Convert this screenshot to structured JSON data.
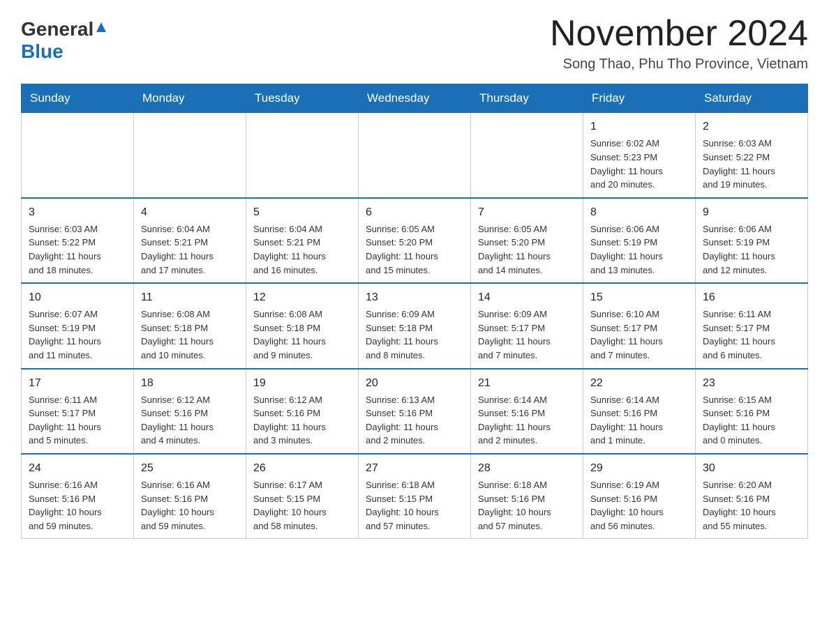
{
  "header": {
    "logo_general": "General",
    "logo_blue": "Blue",
    "month_title": "November 2024",
    "subtitle": "Song Thao, Phu Tho Province, Vietnam"
  },
  "calendar": {
    "days_of_week": [
      "Sunday",
      "Monday",
      "Tuesday",
      "Wednesday",
      "Thursday",
      "Friday",
      "Saturday"
    ],
    "weeks": [
      [
        {
          "day": "",
          "info": ""
        },
        {
          "day": "",
          "info": ""
        },
        {
          "day": "",
          "info": ""
        },
        {
          "day": "",
          "info": ""
        },
        {
          "day": "",
          "info": ""
        },
        {
          "day": "1",
          "info": "Sunrise: 6:02 AM\nSunset: 5:23 PM\nDaylight: 11 hours\nand 20 minutes."
        },
        {
          "day": "2",
          "info": "Sunrise: 6:03 AM\nSunset: 5:22 PM\nDaylight: 11 hours\nand 19 minutes."
        }
      ],
      [
        {
          "day": "3",
          "info": "Sunrise: 6:03 AM\nSunset: 5:22 PM\nDaylight: 11 hours\nand 18 minutes."
        },
        {
          "day": "4",
          "info": "Sunrise: 6:04 AM\nSunset: 5:21 PM\nDaylight: 11 hours\nand 17 minutes."
        },
        {
          "day": "5",
          "info": "Sunrise: 6:04 AM\nSunset: 5:21 PM\nDaylight: 11 hours\nand 16 minutes."
        },
        {
          "day": "6",
          "info": "Sunrise: 6:05 AM\nSunset: 5:20 PM\nDaylight: 11 hours\nand 15 minutes."
        },
        {
          "day": "7",
          "info": "Sunrise: 6:05 AM\nSunset: 5:20 PM\nDaylight: 11 hours\nand 14 minutes."
        },
        {
          "day": "8",
          "info": "Sunrise: 6:06 AM\nSunset: 5:19 PM\nDaylight: 11 hours\nand 13 minutes."
        },
        {
          "day": "9",
          "info": "Sunrise: 6:06 AM\nSunset: 5:19 PM\nDaylight: 11 hours\nand 12 minutes."
        }
      ],
      [
        {
          "day": "10",
          "info": "Sunrise: 6:07 AM\nSunset: 5:19 PM\nDaylight: 11 hours\nand 11 minutes."
        },
        {
          "day": "11",
          "info": "Sunrise: 6:08 AM\nSunset: 5:18 PM\nDaylight: 11 hours\nand 10 minutes."
        },
        {
          "day": "12",
          "info": "Sunrise: 6:08 AM\nSunset: 5:18 PM\nDaylight: 11 hours\nand 9 minutes."
        },
        {
          "day": "13",
          "info": "Sunrise: 6:09 AM\nSunset: 5:18 PM\nDaylight: 11 hours\nand 8 minutes."
        },
        {
          "day": "14",
          "info": "Sunrise: 6:09 AM\nSunset: 5:17 PM\nDaylight: 11 hours\nand 7 minutes."
        },
        {
          "day": "15",
          "info": "Sunrise: 6:10 AM\nSunset: 5:17 PM\nDaylight: 11 hours\nand 7 minutes."
        },
        {
          "day": "16",
          "info": "Sunrise: 6:11 AM\nSunset: 5:17 PM\nDaylight: 11 hours\nand 6 minutes."
        }
      ],
      [
        {
          "day": "17",
          "info": "Sunrise: 6:11 AM\nSunset: 5:17 PM\nDaylight: 11 hours\nand 5 minutes."
        },
        {
          "day": "18",
          "info": "Sunrise: 6:12 AM\nSunset: 5:16 PM\nDaylight: 11 hours\nand 4 minutes."
        },
        {
          "day": "19",
          "info": "Sunrise: 6:12 AM\nSunset: 5:16 PM\nDaylight: 11 hours\nand 3 minutes."
        },
        {
          "day": "20",
          "info": "Sunrise: 6:13 AM\nSunset: 5:16 PM\nDaylight: 11 hours\nand 2 minutes."
        },
        {
          "day": "21",
          "info": "Sunrise: 6:14 AM\nSunset: 5:16 PM\nDaylight: 11 hours\nand 2 minutes."
        },
        {
          "day": "22",
          "info": "Sunrise: 6:14 AM\nSunset: 5:16 PM\nDaylight: 11 hours\nand 1 minute."
        },
        {
          "day": "23",
          "info": "Sunrise: 6:15 AM\nSunset: 5:16 PM\nDaylight: 11 hours\nand 0 minutes."
        }
      ],
      [
        {
          "day": "24",
          "info": "Sunrise: 6:16 AM\nSunset: 5:16 PM\nDaylight: 10 hours\nand 59 minutes."
        },
        {
          "day": "25",
          "info": "Sunrise: 6:16 AM\nSunset: 5:16 PM\nDaylight: 10 hours\nand 59 minutes."
        },
        {
          "day": "26",
          "info": "Sunrise: 6:17 AM\nSunset: 5:15 PM\nDaylight: 10 hours\nand 58 minutes."
        },
        {
          "day": "27",
          "info": "Sunrise: 6:18 AM\nSunset: 5:15 PM\nDaylight: 10 hours\nand 57 minutes."
        },
        {
          "day": "28",
          "info": "Sunrise: 6:18 AM\nSunset: 5:16 PM\nDaylight: 10 hours\nand 57 minutes."
        },
        {
          "day": "29",
          "info": "Sunrise: 6:19 AM\nSunset: 5:16 PM\nDaylight: 10 hours\nand 56 minutes."
        },
        {
          "day": "30",
          "info": "Sunrise: 6:20 AM\nSunset: 5:16 PM\nDaylight: 10 hours\nand 55 minutes."
        }
      ]
    ]
  }
}
